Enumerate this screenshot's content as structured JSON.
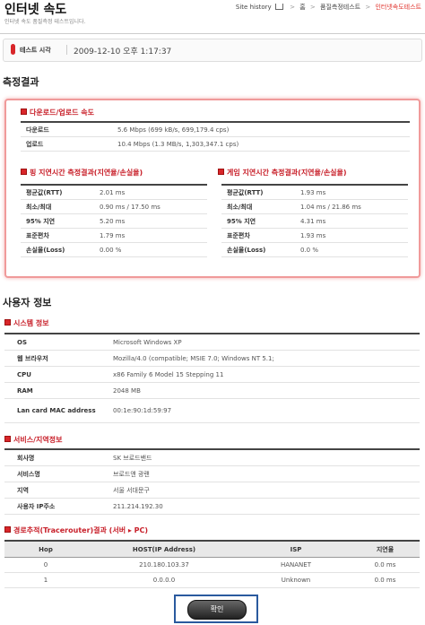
{
  "header": {
    "title": "인터넷 속도",
    "subtitle": "인터넷 속도 품질측정 테스트입니다.",
    "breadcrumb": {
      "site_history": "Site history",
      "home": "홈",
      "level1": "품질측정테스트",
      "current": "인터넷속도테스트",
      "separator": ">"
    }
  },
  "test_time": {
    "label": "테스트 시각",
    "value": "2009-12-10 오후 1:17:37"
  },
  "results": {
    "section_title": "측정결과",
    "download_upload": {
      "title": "다운로드/업로드 속도",
      "rows": [
        {
          "label": "다운로드",
          "value": "5.6 Mbps (699 kB/s, 699,179.4 cps)"
        },
        {
          "label": "업로드",
          "value": "10.4 Mbps (1.3 MB/s, 1,303,347.1 cps)"
        }
      ]
    },
    "ping": {
      "title": "핑 지연시간 측정결과(지연율/손실율)",
      "rows": [
        {
          "label": "평균값(RTT)",
          "value": "2.01 ms"
        },
        {
          "label": "최소/최대",
          "value": "0.90 ms / 17.50 ms"
        },
        {
          "label": "95% 지연",
          "value": "5.20 ms"
        },
        {
          "label": "표준편차",
          "value": "1.79 ms"
        },
        {
          "label": "손실율(Loss)",
          "value": "0.00 %"
        }
      ]
    },
    "game": {
      "title": "게임 지연시간 측정결과(지연율/손실율)",
      "rows": [
        {
          "label": "평균값(RTT)",
          "value": "1.93 ms"
        },
        {
          "label": "최소/최대",
          "value": "1.04 ms / 21.86 ms"
        },
        {
          "label": "95% 지연",
          "value": "4.31 ms"
        },
        {
          "label": "표준편차",
          "value": "1.93 ms"
        },
        {
          "label": "손실율(Loss)",
          "value": "0.0 %"
        }
      ]
    }
  },
  "user_info": {
    "section_title": "사용자 정보",
    "system": {
      "title": "시스템 정보",
      "rows": [
        {
          "label": "OS",
          "value": "Microsoft Windows XP"
        },
        {
          "label": "웹 브라우저",
          "value": "Mozilla/4.0 (compatible; MSIE 7.0; Windows NT 5.1;"
        },
        {
          "label": "CPU",
          "value": "x86 Family 6 Model 15 Stepping 11"
        },
        {
          "label": "RAM",
          "value": "2048 MB"
        },
        {
          "label": "Lan card MAC address",
          "value": "00:1e:90:1d:59:97"
        }
      ]
    },
    "service": {
      "title": "서비스/지역정보",
      "rows": [
        {
          "label": "회사명",
          "value": "SK 브로드밴드"
        },
        {
          "label": "서비스명",
          "value": "브로드앤 광랜"
        },
        {
          "label": "지역",
          "value": "서울 서대문구"
        },
        {
          "label": "사용자 IP주소",
          "value": "211.214.192.30"
        }
      ]
    },
    "traceroute": {
      "title": "경로추적(Tracerouter)결과 (서버 ▸ PC)",
      "headers": [
        "Hop",
        "HOST(IP Address)",
        "ISP",
        "지연율"
      ],
      "rows": [
        [
          "0",
          "210.180.103.37",
          "HANANET",
          "0.0 ms"
        ],
        [
          "1",
          "0.0.0.0",
          "Unknown",
          "0.0 ms"
        ]
      ]
    }
  },
  "confirm_button": "확인",
  "colors": {
    "accent_red": "#d8262a",
    "highlight_frame": "#2a5a9e"
  }
}
